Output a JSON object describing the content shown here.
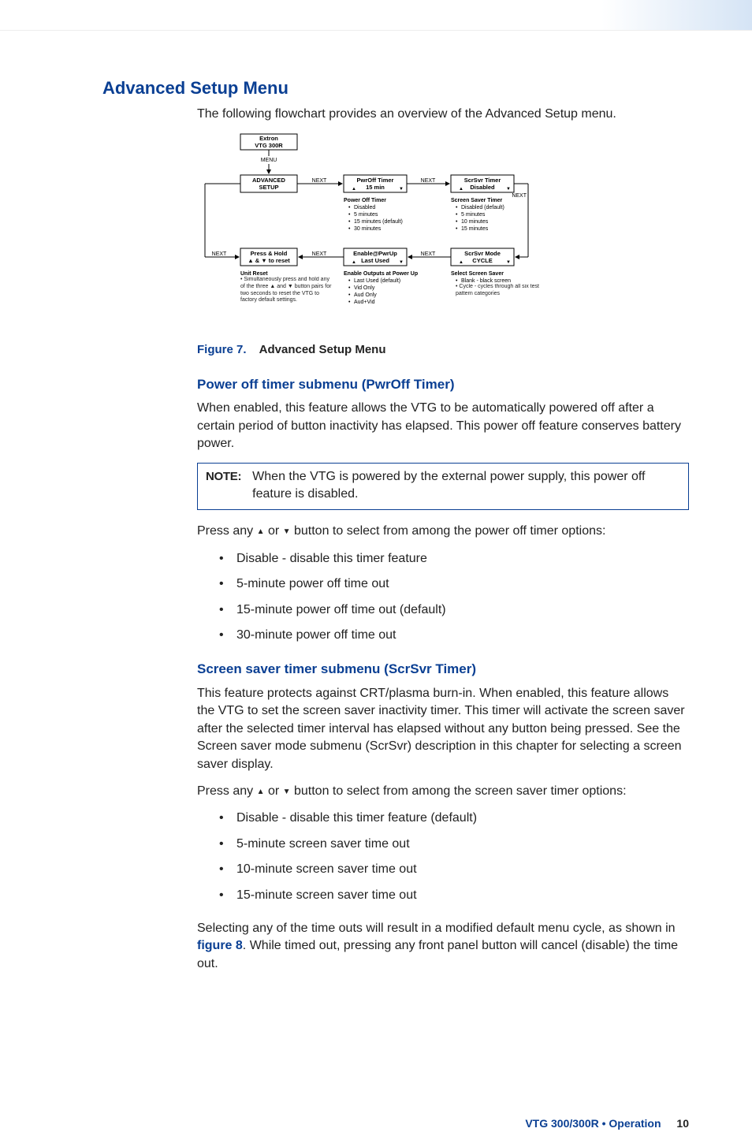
{
  "title": "Advanced Setup Menu",
  "intro": "The following flowchart provides an overview of the Advanced Setup menu.",
  "figure": {
    "label": "Figure 7.",
    "title": "Advanced Setup Menu"
  },
  "flowchart": {
    "device_line1": "Extron",
    "device_line2": "VTG  300R",
    "menu_label": "MENU",
    "next": "NEXT",
    "row1": {
      "adv_l1": "ADVANCED",
      "adv_l2": "SETUP",
      "pwroff_l1": "PwrOff Timer",
      "pwroff_l2": "15 min",
      "scrsvr_l1": "ScrSvr Timer",
      "scrsvr_l2": "Disabled"
    },
    "row1_opts": {
      "pwroff_title": "Power Off Timer",
      "pwroff": [
        "Disabled",
        "5 minutes",
        "15 minutes (default)",
        "30 minutes"
      ],
      "scrsvr_title": "Screen Saver Timer",
      "scrsvr": [
        "Disabled (default)",
        "5 minutes",
        "10 minutes",
        "15 minutes"
      ]
    },
    "row2": {
      "press_l1": "Press & Hold",
      "press_l2": "▲ & ▼  to reset",
      "enable_l1": "Enable@PwrUp",
      "enable_l2": "Last  Used",
      "mode_l1": "ScrSvr Mode",
      "mode_l2": "CYCLE"
    },
    "row2_opts": {
      "reset_title": "Unit Reset",
      "reset_text": "Simultaneously press and hold any of the three ▲ and ▼ button pairs for two seconds to reset the VTG to factory default settings.",
      "enable_title": "Enable Outputs at Power Up",
      "enable": [
        "Last Used (default)",
        "Vid Only",
        "Aud Only",
        "Aud+Vid"
      ],
      "select_title": "Select Screen Saver",
      "select": [
        "Blank - black screen",
        "Cycle - cycles through all six test pattern categories"
      ]
    }
  },
  "pwroff": {
    "heading": "Power off timer submenu (PwrOff Timer)",
    "para": "When enabled, this feature allows the VTG to be automatically powered off after a certain period of button inactivity has elapsed. This power off feature conserves battery power.",
    "note_label": "NOTE:",
    "note_text": "When the VTG is powered by the external power supply, this power off feature is disabled.",
    "press_prefix": "Press any ",
    "press_mid": " or ",
    "press_suffix": " button to select from among the power off timer options:",
    "items": [
      "Disable - disable this timer feature",
      "5-minute power off time out",
      "15-minute power off time out (default)",
      "30-minute power off time out"
    ]
  },
  "scrsvr": {
    "heading": "Screen saver timer submenu (ScrSvr Timer)",
    "para1": "This feature protects against CRT/plasma burn-in. When enabled, this feature allows the VTG to set the screen saver inactivity timer. This timer will activate the screen saver after the selected timer interval has elapsed without any button being pressed.  See the Screen saver mode submenu (ScrSvr) description in this chapter for selecting a screen saver display.",
    "press_prefix": "Press any ",
    "press_mid": " or ",
    "press_suffix": " button to select from among the screen saver timer options:",
    "items": [
      "Disable - disable this timer feature (default)",
      "5-minute screen saver time out",
      "10-minute screen saver time out",
      "15-minute screen saver time out"
    ],
    "para2_a": "Selecting any of the time outs will result in a modified default menu cycle, as shown in ",
    "fig8": "figure 8",
    "para2_b": ". While timed out, pressing any front panel button will cancel (disable) the time out."
  },
  "footer": {
    "doc": "VTG 300/300R • Operation",
    "page": "10"
  }
}
